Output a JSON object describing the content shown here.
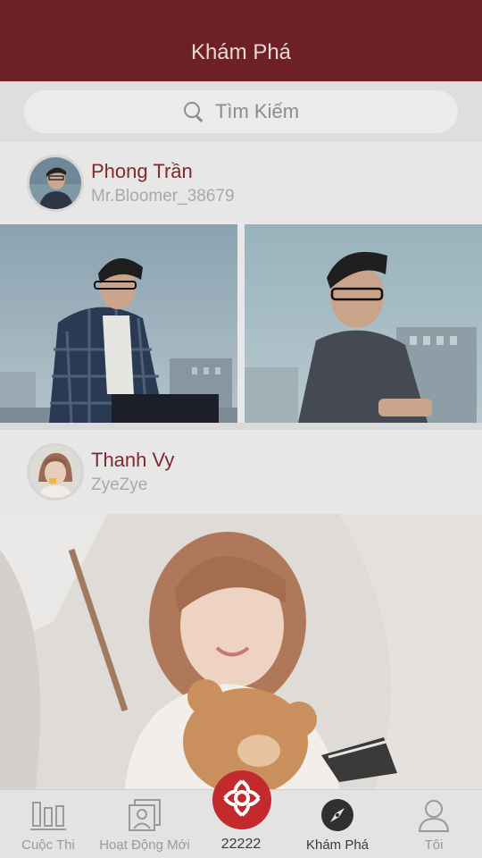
{
  "header": {
    "title": "Khám Phá"
  },
  "search": {
    "placeholder": "Tìm Kiếm"
  },
  "posts": [
    {
      "display_name": "Phong Trần",
      "username": "Mr.Bloomer_38679"
    },
    {
      "display_name": "Thanh Vy",
      "username": "ZyeZye"
    }
  ],
  "tabbar": {
    "items": [
      {
        "label": "Cuộc Thi",
        "icon": "bar-chart-icon"
      },
      {
        "label": "Hoạt Động Mới",
        "icon": "portrait-frame-icon"
      },
      {
        "label": "22222",
        "icon": "flower-icon"
      },
      {
        "label": "Khám Phá",
        "icon": "compass-icon"
      },
      {
        "label": "Tôi",
        "icon": "person-icon"
      }
    ]
  },
  "colors": {
    "header": "#6e2124",
    "accent": "#c22a2e",
    "name": "#7e2a2e"
  }
}
